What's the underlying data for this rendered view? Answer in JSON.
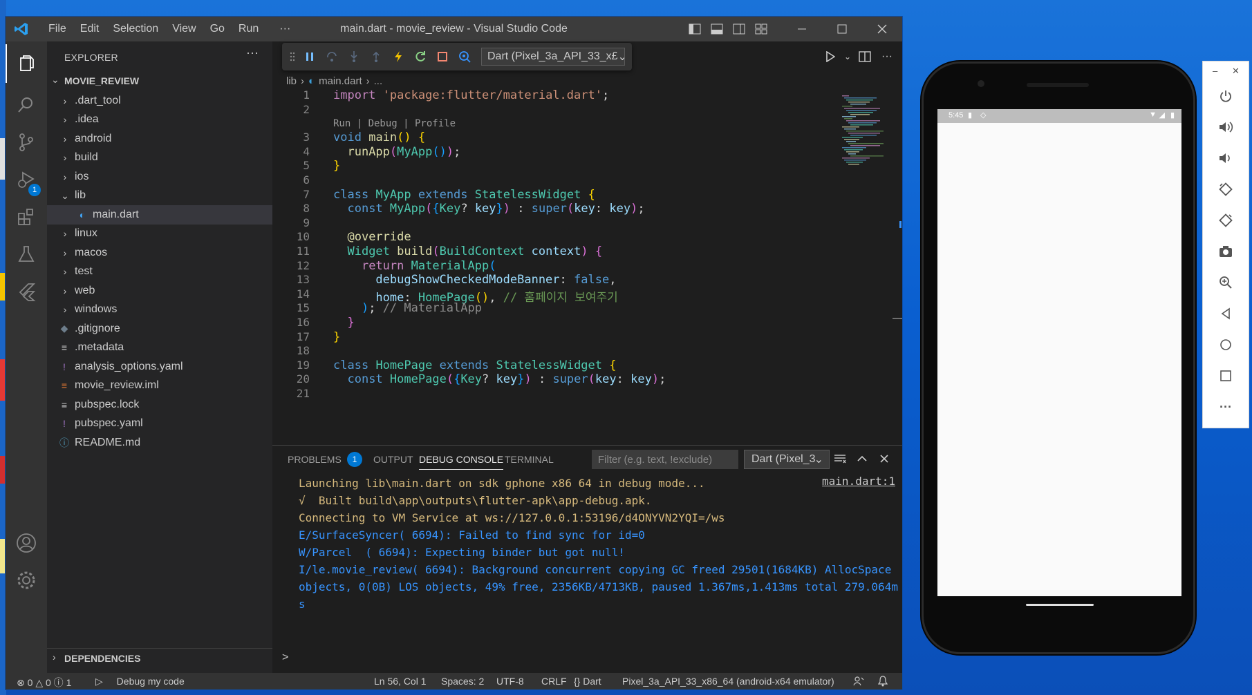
{
  "window": {
    "title": "main.dart - movie_review - Visual Studio Code",
    "menu": [
      "File",
      "Edit",
      "Selection",
      "View",
      "Go",
      "Run",
      "···"
    ]
  },
  "explorer": {
    "header": "EXPLORER",
    "more": "···",
    "project": "MOVIE_REVIEW",
    "items": [
      {
        "label": ".dart_tool",
        "type": "folder"
      },
      {
        "label": ".idea",
        "type": "folder"
      },
      {
        "label": "android",
        "type": "folder"
      },
      {
        "label": "build",
        "type": "folder"
      },
      {
        "label": "ios",
        "type": "folder"
      },
      {
        "label": "lib",
        "type": "folder-open"
      },
      {
        "label": "main.dart",
        "type": "dart"
      },
      {
        "label": "linux",
        "type": "folder"
      },
      {
        "label": "macos",
        "type": "folder"
      },
      {
        "label": "test",
        "type": "folder"
      },
      {
        "label": "web",
        "type": "folder"
      },
      {
        "label": "windows",
        "type": "folder"
      },
      {
        "label": ".gitignore",
        "type": "git"
      },
      {
        "label": ".metadata",
        "type": "text"
      },
      {
        "label": "analysis_options.yaml",
        "type": "yaml"
      },
      {
        "label": "movie_review.iml",
        "type": "rss"
      },
      {
        "label": "pubspec.lock",
        "type": "text"
      },
      {
        "label": "pubspec.yaml",
        "type": "yaml"
      },
      {
        "label": "README.md",
        "type": "info"
      }
    ],
    "dependencies": "DEPENDENCIES"
  },
  "activity_badge": "1",
  "debug_toolbar": {
    "device": "Dart (Pixel_3a_API_33_x£"
  },
  "breadcrumb": {
    "folder": "lib",
    "file": "main.dart",
    "more": "..."
  },
  "code": {
    "codelens": "Run | Debug | Profile",
    "lines": [
      {
        "n": "1",
        "html": "<span style='color:#c586c0'>import</span> <span style='color:#ce9178'>'package:flutter/material.dart'</span>;"
      },
      {
        "n": "2",
        "html": ""
      },
      {
        "n": "3",
        "html": "<span style='color:#569cd6'>void</span> <span style='color:#dcdcaa'>main</span><span style='color:#ffd700'>()</span> <span style='color:#ffd700'>{</span>"
      },
      {
        "n": "4",
        "html": "  <span style='color:#dcdcaa'>runApp</span><span style='color:#da70d6'>(</span><span style='color:#4ec9b0'>MyApp</span><span style='color:#179fff'>()</span><span style='color:#da70d6'>)</span>;"
      },
      {
        "n": "5",
        "html": "<span style='color:#ffd700'>}</span>"
      },
      {
        "n": "6",
        "html": ""
      },
      {
        "n": "7",
        "html": "<span style='color:#569cd6'>class</span> <span style='color:#4ec9b0'>MyApp</span> <span style='color:#569cd6'>extends</span> <span style='color:#4ec9b0'>StatelessWidget</span> <span style='color:#ffd700'>{</span>"
      },
      {
        "n": "8",
        "html": "  <span style='color:#569cd6'>const</span> <span style='color:#4ec9b0'>MyApp</span><span style='color:#da70d6'>(</span><span style='color:#179fff'>{</span><span style='color:#4ec9b0'>Key</span>? <span style='color:#9cdcfe'>key</span><span style='color:#179fff'>}</span><span style='color:#da70d6'>)</span> : <span style='color:#569cd6'>super</span><span style='color:#da70d6'>(</span><span style='color:#9cdcfe'>key</span>: <span style='color:#9cdcfe'>key</span><span style='color:#da70d6'>)</span>;"
      },
      {
        "n": "9",
        "html": ""
      },
      {
        "n": "10",
        "html": "  <span style='color:#dcdcaa'>@override</span>"
      },
      {
        "n": "11",
        "html": "  <span style='color:#4ec9b0'>Widget</span> <span style='color:#dcdcaa'>build</span><span style='color:#da70d6'>(</span><span style='color:#4ec9b0'>BuildContext</span> <span style='color:#9cdcfe'>context</span><span style='color:#da70d6'>)</span> <span style='color:#da70d6'>{</span>"
      },
      {
        "n": "12",
        "html": "    <span style='color:#c586c0'>return</span> <span style='color:#4ec9b0'>MaterialApp</span><span style='color:#179fff'>(</span>"
      },
      {
        "n": "13",
        "html": "      <span style='color:#9cdcfe'>debugShowCheckedModeBanner</span>: <span style='color:#569cd6'>false</span>,"
      },
      {
        "n": "14",
        "html": "      <span style='color:#9cdcfe'>home</span>: <span style='color:#4ec9b0'>HomePage</span><span style='color:#ffd700'>()</span>, <span style='color:#6a9955'>// 홈페이지 보여주기</span>"
      },
      {
        "n": "15",
        "html": "    <span style='color:#179fff'>)</span>; <span style='color:#8b8b8b'>// MaterialApp</span>"
      },
      {
        "n": "16",
        "html": "  <span style='color:#da70d6'>}</span>"
      },
      {
        "n": "17",
        "html": "<span style='color:#ffd700'>}</span>"
      },
      {
        "n": "18",
        "html": ""
      },
      {
        "n": "19",
        "html": "<span style='color:#569cd6'>class</span> <span style='color:#4ec9b0'>HomePage</span> <span style='color:#569cd6'>extends</span> <span style='color:#4ec9b0'>StatelessWidget</span> <span style='color:#ffd700'>{</span>"
      },
      {
        "n": "20",
        "html": "  <span style='color:#569cd6'>const</span> <span style='color:#4ec9b0'>HomePage</span><span style='color:#da70d6'>(</span><span style='color:#179fff'>{</span><span style='color:#4ec9b0'>Key</span>? <span style='color:#9cdcfe'>key</span><span style='color:#179fff'>}</span><span style='color:#da70d6'>)</span> : <span style='color:#569cd6'>super</span><span style='color:#da70d6'>(</span><span style='color:#9cdcfe'>key</span>: <span style='color:#9cdcfe'>key</span><span style='color:#da70d6'>)</span>;"
      },
      {
        "n": "21",
        "html": ""
      }
    ]
  },
  "panel": {
    "tabs": [
      "PROBLEMS",
      "OUTPUT",
      "DEBUG CONSOLE",
      "TERMINAL"
    ],
    "problems_count": "1",
    "filter_placeholder": "Filter (e.g. text, !exclude)",
    "device": "Dart (Pixel_3",
    "source_link": "main.dart:1",
    "prompt": ">",
    "console": [
      {
        "text": "Launching lib\\main.dart on sdk gphone x86 64 in debug mode...",
        "color": "#d7ba7d"
      },
      {
        "text": "√  Built build\\app\\outputs\\flutter-apk\\app-debug.apk.",
        "color": "#d7ba7d"
      },
      {
        "text": "Connecting to VM Service at ws://127.0.0.1:53196/d4ONYVN2YQI=/ws",
        "color": "#d7ba7d"
      },
      {
        "text": "E/SurfaceSyncer( 6694): Failed to find sync for id=0",
        "color": "#3794ff"
      },
      {
        "text": "W/Parcel  ( 6694): Expecting binder but got null!",
        "color": "#3794ff"
      },
      {
        "text": "I/le.movie_review( 6694): Background concurrent copying GC freed 29501(1684KB) AllocSpace objects, 0(0B) LOS objects, 49% free, 2356KB/4713KB, paused 1.367ms,1.413ms total 279.064ms",
        "color": "#3794ff"
      }
    ]
  },
  "status": {
    "errors": "0",
    "warnings": "0",
    "infos": "1",
    "debug": "Debug my code",
    "position": "Ln 56, Col 1",
    "spaces": "Spaces: 2",
    "encoding": "UTF-8",
    "eol": "CRLF",
    "language": "Dart",
    "device": "Pixel_3a_API_33_x86_64 (android-x64 emulator)"
  },
  "emulator": {
    "time": "5:45"
  },
  "colors": {
    "accent": "#0078d4",
    "desktop": "#0a5fd0"
  }
}
